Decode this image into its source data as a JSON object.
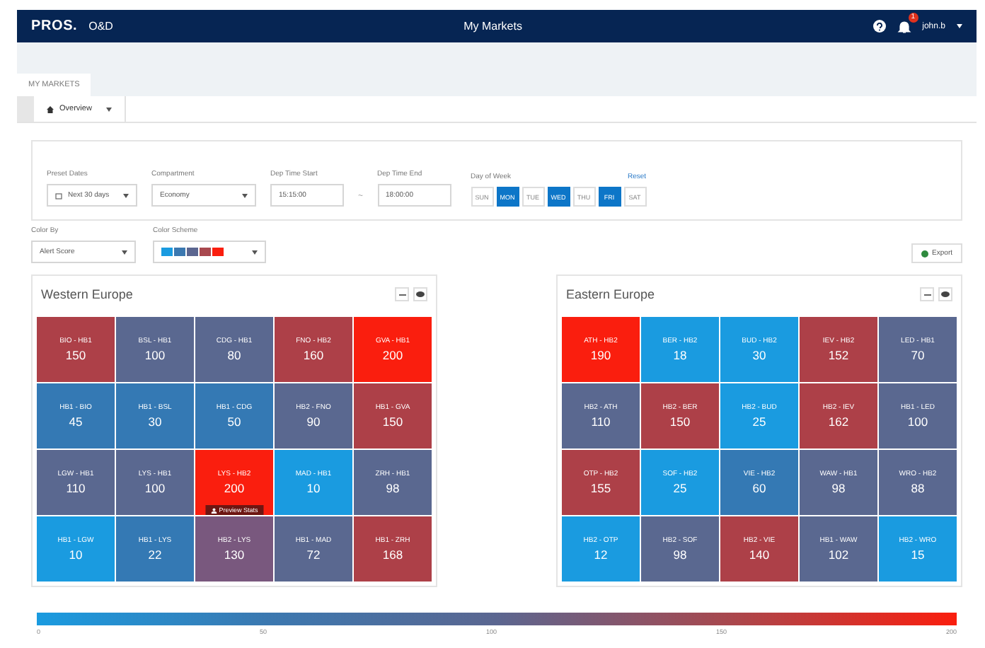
{
  "header": {
    "logo": "PROS.",
    "product": "O&D",
    "title": "My Markets",
    "notification_count": "1",
    "user": "john.b"
  },
  "page_tab": {
    "label": "MY MARKETS",
    "selected": true
  },
  "view_tab": {
    "label": "Overview",
    "selected": true
  },
  "filters": {
    "preset_dates": {
      "label": "Preset Dates",
      "value": "Next 30 days"
    },
    "compartment": {
      "label": "Compartment",
      "value": "Economy"
    },
    "dep_time_start": {
      "label": "Dep Time Start",
      "value": "15:15:00"
    },
    "time_separator": "~",
    "dep_time_end": {
      "label": "Dep Time End",
      "value": "18:00:00"
    },
    "day_of_week": {
      "label": "Day of Week",
      "reset": "Reset",
      "days": [
        {
          "label": "SUN",
          "selected": false
        },
        {
          "label": "MON",
          "selected": true
        },
        {
          "label": "TUE",
          "selected": false
        },
        {
          "label": "WED",
          "selected": true
        },
        {
          "label": "THU",
          "selected": false
        },
        {
          "label": "FRI",
          "selected": true
        },
        {
          "label": "SAT",
          "selected": false
        }
      ]
    }
  },
  "color_by": {
    "label": "Color By",
    "value": "Alert Score"
  },
  "color_scheme": {
    "label": "Color Scheme",
    "swatches": [
      {
        "color": "#1a9be0"
      },
      {
        "color": "#3b78b0"
      },
      {
        "color": "#5b6690"
      },
      {
        "color": "#a8484e"
      },
      {
        "color": "#fa1e0e"
      }
    ]
  },
  "export_button": "Export",
  "panels": [
    {
      "title": "Western Europe",
      "cells": [
        {
          "route": "BIO - HB1",
          "value": "150",
          "color": "#ad4048"
        },
        {
          "route": "BSL - HB1",
          "value": "100",
          "color": "#5a6890"
        },
        {
          "route": "CDG - HB1",
          "value": "80",
          "color": "#5a6890"
        },
        {
          "route": "FNO - HB2",
          "value": "160",
          "color": "#ad4048"
        },
        {
          "route": "GVA - HB1",
          "value": "200",
          "color": "#fa1e0e"
        },
        {
          "route": "HB1 - BIO",
          "value": "45",
          "color": "#3479b4"
        },
        {
          "route": "HB1 - BSL",
          "value": "30",
          "color": "#3479b4"
        },
        {
          "route": "HB1 - CDG",
          "value": "50",
          "color": "#3479b4"
        },
        {
          "route": "HB2 - FNO",
          "value": "90",
          "color": "#5a6890"
        },
        {
          "route": "HB1 - GVA",
          "value": "150",
          "color": "#ad4048"
        },
        {
          "route": "LGW - HB1",
          "value": "110",
          "color": "#5a6890"
        },
        {
          "route": "LYS - HB1",
          "value": "100",
          "color": "#5a6890"
        },
        {
          "route": "LYS - HB2",
          "value": "200",
          "color": "#fa1e0e",
          "tooltip": "Preview Stats"
        },
        {
          "route": "MAD - HB1",
          "value": "10",
          "color": "#1a9be0"
        },
        {
          "route": "ZRH - HB1",
          "value": "98",
          "color": "#5a6890"
        },
        {
          "route": "HB1 - LGW",
          "value": "10",
          "color": "#1a9be0"
        },
        {
          "route": "HB1 - LYS",
          "value": "22",
          "color": "#3479b4"
        },
        {
          "route": "HB2 - LYS",
          "value": "130",
          "color": "#79587e"
        },
        {
          "route": "HB1 - MAD",
          "value": "72",
          "color": "#5a6890"
        },
        {
          "route": "HB1 - ZRH",
          "value": "168",
          "color": "#ad4048"
        }
      ]
    },
    {
      "title": "Eastern Europe",
      "cells": [
        {
          "route": "ATH - HB2",
          "value": "190",
          "color": "#fa1e0e"
        },
        {
          "route": "BER - HB2",
          "value": "18",
          "color": "#1a9be0"
        },
        {
          "route": "BUD - HB2",
          "value": "30",
          "color": "#1a9be0"
        },
        {
          "route": "IEV - HB2",
          "value": "152",
          "color": "#ad4048"
        },
        {
          "route": "LED - HB1",
          "value": "70",
          "color": "#5a6890"
        },
        {
          "route": "HB2 - ATH",
          "value": "110",
          "color": "#5a6890"
        },
        {
          "route": "HB2 - BER",
          "value": "150",
          "color": "#ad4048"
        },
        {
          "route": "HB2 - BUD",
          "value": "25",
          "color": "#1a9be0"
        },
        {
          "route": "HB2 - IEV",
          "value": "162",
          "color": "#ad4048"
        },
        {
          "route": "HB1 - LED",
          "value": "100",
          "color": "#5a6890"
        },
        {
          "route": "OTP - HB2",
          "value": "155",
          "color": "#ad4048"
        },
        {
          "route": "SOF - HB2",
          "value": "25",
          "color": "#1a9be0"
        },
        {
          "route": "VIE - HB2",
          "value": "60",
          "color": "#3479b4"
        },
        {
          "route": "WAW - HB1",
          "value": "98",
          "color": "#5a6890"
        },
        {
          "route": "WRO - HB2",
          "value": "88",
          "color": "#5a6890"
        },
        {
          "route": "HB2 - OTP",
          "value": "12",
          "color": "#1a9be0"
        },
        {
          "route": "HB2 - SOF",
          "value": "98",
          "color": "#5a6890"
        },
        {
          "route": "HB2 - VIE",
          "value": "140",
          "color": "#ad4048"
        },
        {
          "route": "HB1 - WAW",
          "value": "102",
          "color": "#5a6890"
        },
        {
          "route": "HB2 - WRO",
          "value": "15",
          "color": "#1a9be0"
        }
      ]
    }
  ],
  "legend": {
    "ticks": [
      "0",
      "50",
      "100",
      "150",
      "200"
    ]
  }
}
